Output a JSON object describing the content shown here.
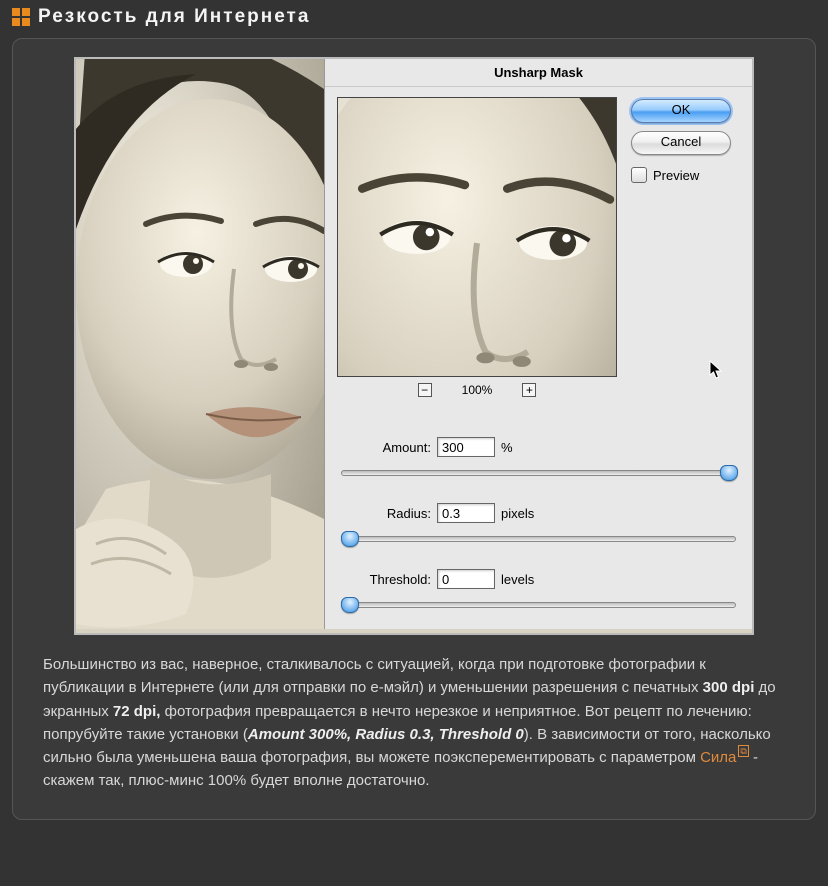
{
  "header": {
    "title": "Резкость для Интернета"
  },
  "dialog": {
    "title": "Unsharp Mask",
    "ok_label": "OK",
    "cancel_label": "Cancel",
    "preview_label": "Preview",
    "zoom_level": "100%",
    "amount": {
      "label": "Amount:",
      "value": "300",
      "unit": "%",
      "thumb_pct": 98
    },
    "radius": {
      "label": "Radius:",
      "value": "0.3",
      "unit": "pixels",
      "thumb_pct": 2
    },
    "threshold": {
      "label": "Threshold:",
      "value": "0",
      "unit": "levels",
      "thumb_pct": 2
    }
  },
  "article": {
    "p1a": "Большинство из вас, наверное, сталкивалось с ситуацией, когда при подготовке фотографии к публикации в Интернете (или для отправки по е-мэйл) и уменьшении разрешения с печатных ",
    "p1b": "300 dpi",
    "p1c": " до экранных ",
    "p1d": "72 dpi,",
    "p1e": " фотография превращается в нечто нерезкое и неприятное. Вот рецепт по лечению: попрубуйте такие установки (",
    "p1f": "Amount 300%, Radius 0.3, Threshold 0",
    "p1g": "). В зависимости от того, насколько сильно была уменьшена ваша фотография, вы можете поэксперементировать с параметром ",
    "link": "Сила",
    "p1h": " - скажем так, плюс-минс 100% будет вполне достаточно."
  }
}
